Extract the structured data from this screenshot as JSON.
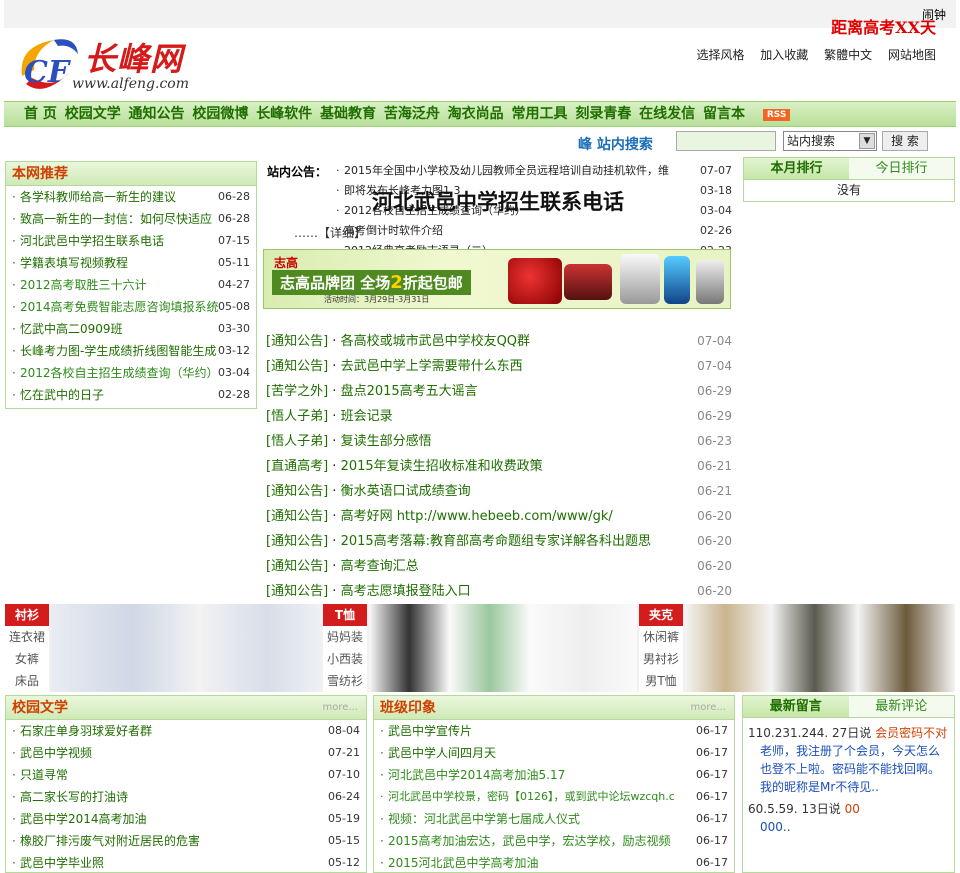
{
  "header": {
    "alarm": "闹钟",
    "countdown": "距离高考XX天",
    "logo_text": "长峰网",
    "logo_url": "www.alfeng.com",
    "links": [
      "选择风格",
      "加入收藏",
      "繁體中文",
      "网站地图"
    ]
  },
  "nav": {
    "items": [
      "首 页",
      "校园文学",
      "通知公告",
      "校园微博",
      "长峰软件",
      "基础教育",
      "苦海泛舟",
      "淘衣尚品",
      "常用工具",
      "刻录青春",
      "在线发信",
      "留言本"
    ],
    "rss": "RSS"
  },
  "search": {
    "title": "峰 站内搜索",
    "select_value": "站内搜索",
    "button": "搜 索"
  },
  "recommend": {
    "title": "本网推荐",
    "items": [
      {
        "title": "各学科教师给高一新生的建议",
        "date": "06-28"
      },
      {
        "title": "致高一新生的一封信：如何尽快适应",
        "date": "06-28"
      },
      {
        "title": "河北武邑中学招生联系电话",
        "date": "07-15"
      },
      {
        "title": "学籍表填写视频教程",
        "date": "05-11"
      },
      {
        "title": "2012高考取胜三十六计",
        "date": "04-27"
      },
      {
        "title": "2014高考免费智能志愿咨询填报系统",
        "date": "05-08"
      },
      {
        "title": "忆武中高二0909班",
        "date": "03-30"
      },
      {
        "title": "长峰考力图-学生成绩折线图智能生成",
        "date": "03-12"
      },
      {
        "title": "2012各校自主招生成绩查询（华约）",
        "date": "03-04"
      },
      {
        "title": "忆在武中的日子",
        "date": "02-28"
      }
    ]
  },
  "notice": {
    "label": "站内公告：",
    "items": [
      {
        "title": "2015年全国中小学校及幼儿园教师全员远程培训自动挂机软件，维",
        "date": "07-07"
      },
      {
        "title": "即将发布长峰考力图1.3",
        "date": "03-18"
      },
      {
        "title": "2012各校自主招生成绩查询（华约）",
        "date": "03-04"
      },
      {
        "title": "高考倒计时软件介绍",
        "date": "02-26"
      },
      {
        "title": "2012经典高考励志语录（二）",
        "date": "02-23"
      }
    ],
    "overlay_title": "河北武邑中学招生联系电话",
    "detail": "……【详细】"
  },
  "ad": {
    "brand": "志高",
    "slogan_a": "志高品牌团  全场",
    "slogan_big": "2",
    "slogan_b": "折起包邮",
    "date": "活动时间：3月29日-3月31日"
  },
  "news": [
    {
      "cat": "[通知公告]",
      "title": "各高校或城市武邑中学校友QQ群",
      "date": "07-04"
    },
    {
      "cat": "[通知公告]",
      "title": "去武邑中学上学需要带什么东西",
      "date": "07-04"
    },
    {
      "cat": "[苦学之外]",
      "title": "盘点2015高考五大谣言",
      "date": "06-29"
    },
    {
      "cat": "[悟人子弟]",
      "title": "班会记录",
      "date": "06-29"
    },
    {
      "cat": "[悟人子弟]",
      "title": "复读生部分感悟",
      "date": "06-23"
    },
    {
      "cat": "[直通高考]",
      "title": "2015年复读生招收标准和收费政策",
      "date": "06-21"
    },
    {
      "cat": "[通知公告]",
      "title": "衡水英语口试成绩查询",
      "date": "06-21"
    },
    {
      "cat": "[通知公告]",
      "title": "高考好网 http://www.hebeeb.com/www/gk/",
      "date": "06-20"
    },
    {
      "cat": "[通知公告]",
      "title": "2015高考落幕:教育部高考命题组专家详解各科出题思",
      "date": "06-20"
    },
    {
      "cat": "[通知公告]",
      "title": "高考查询汇总",
      "date": "06-20"
    },
    {
      "cat": "[通知公告]",
      "title": "高考志愿填报登陆入口",
      "date": "06-20"
    }
  ],
  "rank": {
    "tab_month": "本月排行",
    "tab_today": "今日排行",
    "empty": "没有"
  },
  "clothing": {
    "groups": [
      {
        "head": "衬衫",
        "subs": [
          "连衣裙",
          "女裤",
          "床品"
        ]
      },
      {
        "head": "T恤",
        "subs": [
          "妈妈装",
          "小西装",
          "雪纺衫"
        ]
      },
      {
        "head": "夹克",
        "subs": [
          "休闲裤",
          "男衬衫",
          "男T恤"
        ]
      }
    ]
  },
  "campus": {
    "title": "校园文学",
    "more": "more...",
    "items": [
      {
        "title": "石家庄单身羽球爱好者群",
        "date": "08-04"
      },
      {
        "title": "武邑中学视频",
        "date": "07-21"
      },
      {
        "title": "只道寻常",
        "date": "07-10"
      },
      {
        "title": "高二家长写的打油诗",
        "date": "06-24"
      },
      {
        "title": "武邑中学2014高考加油",
        "date": "05-19"
      },
      {
        "title": "橡胶厂排污废气对附近居民的危害",
        "date": "05-15"
      },
      {
        "title": "武邑中学毕业照",
        "date": "05-12"
      }
    ]
  },
  "class": {
    "title": "班级印象",
    "more": "more...",
    "items": [
      {
        "title": "武邑中学宣传片",
        "date": "06-17"
      },
      {
        "title": "武邑中学人间四月天",
        "date": "06-17"
      },
      {
        "title": "河北武邑中学2014高考加油5.17",
        "date": "06-17"
      },
      {
        "title": "河北武邑中学校景，密码【0126】，或到武中论坛wzcqh.c",
        "date": "06-17"
      },
      {
        "title": "视频：河北武邑中学第七届成人仪式",
        "date": "06-17"
      },
      {
        "title": "2015高考加油宏达，武邑中学，宏达学校，励志视频",
        "date": "06-17"
      },
      {
        "title": "2015河北武邑中学高考加油",
        "date": "06-17"
      }
    ]
  },
  "messages": {
    "tab_latest": "最新留言",
    "tab_comment": "最新评论",
    "entries": [
      {
        "ip": "110.231.244.",
        "time": "27日说",
        "user": "会员密码不对",
        "text": "老师，我注册了个会员，今天怎么也登不上啦。密码能不能找回啊。我的昵称是Mr不待见.."
      },
      {
        "ip": "60.5.59.",
        "time": "13日说",
        "user": "00",
        "text": "000.."
      }
    ]
  },
  "colors": {
    "accent_green": "#1f6e00",
    "title_orange": "#d04000",
    "countdown_red": "#e00000",
    "category_red": "#d31d1d"
  }
}
